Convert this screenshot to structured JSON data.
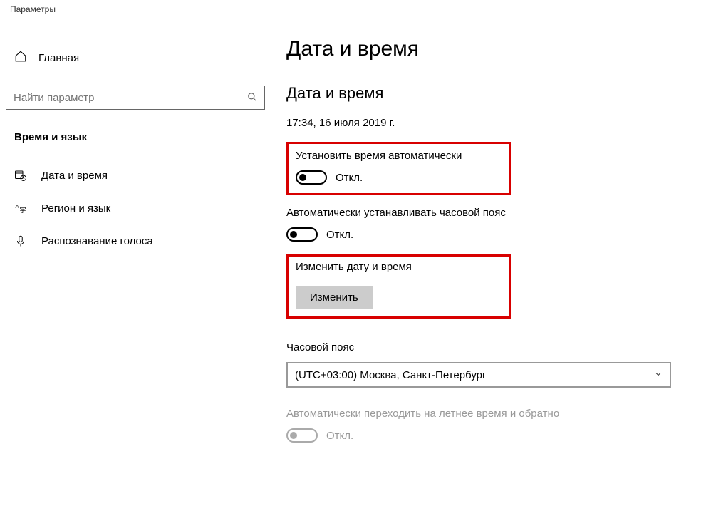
{
  "window": {
    "title": "Параметры"
  },
  "sidebar": {
    "home_label": "Главная",
    "search_placeholder": "Найти параметр",
    "category": "Время и язык",
    "items": [
      {
        "label": "Дата и время"
      },
      {
        "label": "Регион и язык"
      },
      {
        "label": "Распознавание голоса"
      }
    ]
  },
  "main": {
    "heading": "Дата и время",
    "subheading": "Дата и время",
    "current_datetime": "17:34, 16 июля 2019 г.",
    "auto_time": {
      "label": "Установить время автоматически",
      "state_text": "Откл."
    },
    "auto_tz": {
      "label": "Автоматически устанавливать часовой пояс",
      "state_text": "Откл."
    },
    "change_datetime": {
      "label": "Изменить дату и время",
      "button": "Изменить"
    },
    "timezone": {
      "label": "Часовой пояс",
      "selected": "(UTC+03:00) Москва, Санкт-Петербург"
    },
    "dst": {
      "label": "Автоматически переходить на летнее время и обратно",
      "state_text": "Откл."
    }
  }
}
